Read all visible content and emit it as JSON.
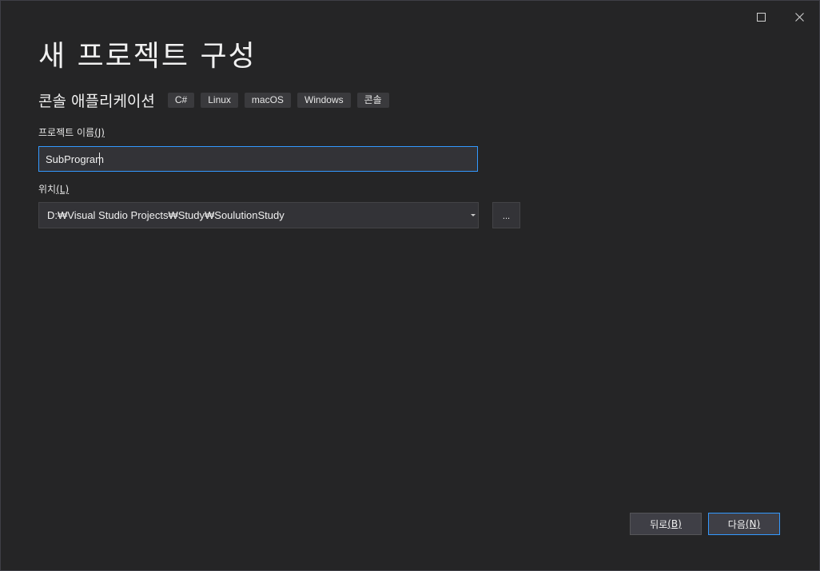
{
  "window": {
    "maximize_icon": "maximize-icon",
    "close_icon": "close-icon",
    "close_glyph": "✕"
  },
  "page": {
    "title": "새 프로젝트 구성"
  },
  "template": {
    "name": "콘솔 애플리케이션",
    "tags": [
      "C#",
      "Linux",
      "macOS",
      "Windows",
      "콘솔"
    ]
  },
  "project_name": {
    "label": "프로젝트 이름",
    "mnemonic": "(J)",
    "value": "SubProgram"
  },
  "location": {
    "label": "위치",
    "mnemonic": "(L)",
    "value": "D:₩Visual Studio Projects₩Study₩SoulutionStudy",
    "browse_label": "..."
  },
  "buttons": {
    "back_label": "뒤로",
    "back_mnemonic": "(B)",
    "next_label": "다음",
    "next_mnemonic": "(N)"
  },
  "colors": {
    "background": "#252526",
    "accent": "#3399ff",
    "input_bg": "#333337"
  }
}
